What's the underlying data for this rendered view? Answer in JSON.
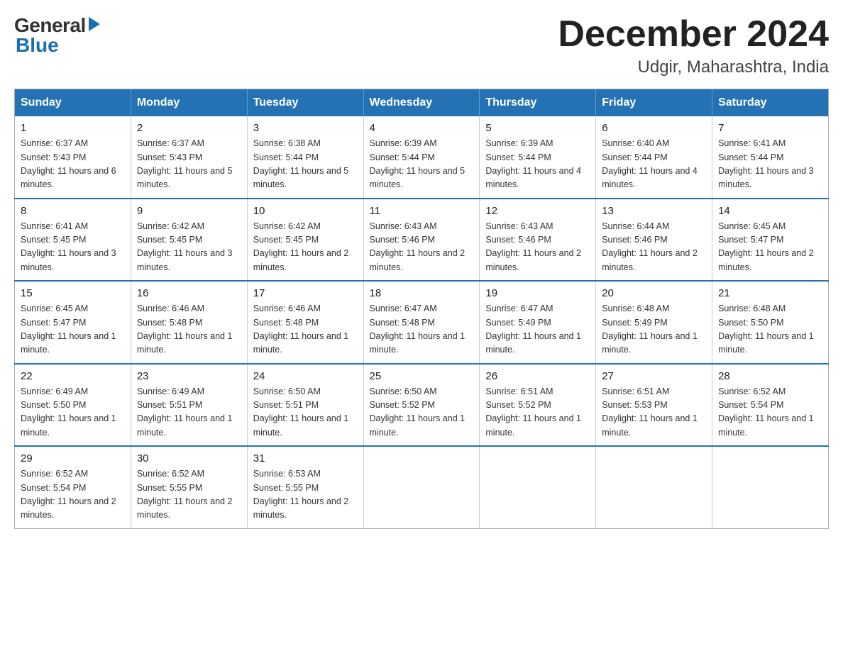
{
  "logo": {
    "general": "General",
    "blue": "Blue"
  },
  "title": {
    "month": "December 2024",
    "location": "Udgir, Maharashtra, India"
  },
  "days_header": [
    "Sunday",
    "Monday",
    "Tuesday",
    "Wednesday",
    "Thursday",
    "Friday",
    "Saturday"
  ],
  "weeks": [
    [
      {
        "day": "1",
        "sunrise": "6:37 AM",
        "sunset": "5:43 PM",
        "daylight": "11 hours and 6 minutes."
      },
      {
        "day": "2",
        "sunrise": "6:37 AM",
        "sunset": "5:43 PM",
        "daylight": "11 hours and 5 minutes."
      },
      {
        "day": "3",
        "sunrise": "6:38 AM",
        "sunset": "5:44 PM",
        "daylight": "11 hours and 5 minutes."
      },
      {
        "day": "4",
        "sunrise": "6:39 AM",
        "sunset": "5:44 PM",
        "daylight": "11 hours and 5 minutes."
      },
      {
        "day": "5",
        "sunrise": "6:39 AM",
        "sunset": "5:44 PM",
        "daylight": "11 hours and 4 minutes."
      },
      {
        "day": "6",
        "sunrise": "6:40 AM",
        "sunset": "5:44 PM",
        "daylight": "11 hours and 4 minutes."
      },
      {
        "day": "7",
        "sunrise": "6:41 AM",
        "sunset": "5:44 PM",
        "daylight": "11 hours and 3 minutes."
      }
    ],
    [
      {
        "day": "8",
        "sunrise": "6:41 AM",
        "sunset": "5:45 PM",
        "daylight": "11 hours and 3 minutes."
      },
      {
        "day": "9",
        "sunrise": "6:42 AM",
        "sunset": "5:45 PM",
        "daylight": "11 hours and 3 minutes."
      },
      {
        "day": "10",
        "sunrise": "6:42 AM",
        "sunset": "5:45 PM",
        "daylight": "11 hours and 2 minutes."
      },
      {
        "day": "11",
        "sunrise": "6:43 AM",
        "sunset": "5:46 PM",
        "daylight": "11 hours and 2 minutes."
      },
      {
        "day": "12",
        "sunrise": "6:43 AM",
        "sunset": "5:46 PM",
        "daylight": "11 hours and 2 minutes."
      },
      {
        "day": "13",
        "sunrise": "6:44 AM",
        "sunset": "5:46 PM",
        "daylight": "11 hours and 2 minutes."
      },
      {
        "day": "14",
        "sunrise": "6:45 AM",
        "sunset": "5:47 PM",
        "daylight": "11 hours and 2 minutes."
      }
    ],
    [
      {
        "day": "15",
        "sunrise": "6:45 AM",
        "sunset": "5:47 PM",
        "daylight": "11 hours and 1 minute."
      },
      {
        "day": "16",
        "sunrise": "6:46 AM",
        "sunset": "5:48 PM",
        "daylight": "11 hours and 1 minute."
      },
      {
        "day": "17",
        "sunrise": "6:46 AM",
        "sunset": "5:48 PM",
        "daylight": "11 hours and 1 minute."
      },
      {
        "day": "18",
        "sunrise": "6:47 AM",
        "sunset": "5:48 PM",
        "daylight": "11 hours and 1 minute."
      },
      {
        "day": "19",
        "sunrise": "6:47 AM",
        "sunset": "5:49 PM",
        "daylight": "11 hours and 1 minute."
      },
      {
        "day": "20",
        "sunrise": "6:48 AM",
        "sunset": "5:49 PM",
        "daylight": "11 hours and 1 minute."
      },
      {
        "day": "21",
        "sunrise": "6:48 AM",
        "sunset": "5:50 PM",
        "daylight": "11 hours and 1 minute."
      }
    ],
    [
      {
        "day": "22",
        "sunrise": "6:49 AM",
        "sunset": "5:50 PM",
        "daylight": "11 hours and 1 minute."
      },
      {
        "day": "23",
        "sunrise": "6:49 AM",
        "sunset": "5:51 PM",
        "daylight": "11 hours and 1 minute."
      },
      {
        "day": "24",
        "sunrise": "6:50 AM",
        "sunset": "5:51 PM",
        "daylight": "11 hours and 1 minute."
      },
      {
        "day": "25",
        "sunrise": "6:50 AM",
        "sunset": "5:52 PM",
        "daylight": "11 hours and 1 minute."
      },
      {
        "day": "26",
        "sunrise": "6:51 AM",
        "sunset": "5:52 PM",
        "daylight": "11 hours and 1 minute."
      },
      {
        "day": "27",
        "sunrise": "6:51 AM",
        "sunset": "5:53 PM",
        "daylight": "11 hours and 1 minute."
      },
      {
        "day": "28",
        "sunrise": "6:52 AM",
        "sunset": "5:54 PM",
        "daylight": "11 hours and 1 minute."
      }
    ],
    [
      {
        "day": "29",
        "sunrise": "6:52 AM",
        "sunset": "5:54 PM",
        "daylight": "11 hours and 2 minutes."
      },
      {
        "day": "30",
        "sunrise": "6:52 AM",
        "sunset": "5:55 PM",
        "daylight": "11 hours and 2 minutes."
      },
      {
        "day": "31",
        "sunrise": "6:53 AM",
        "sunset": "5:55 PM",
        "daylight": "11 hours and 2 minutes."
      },
      null,
      null,
      null,
      null
    ]
  ]
}
